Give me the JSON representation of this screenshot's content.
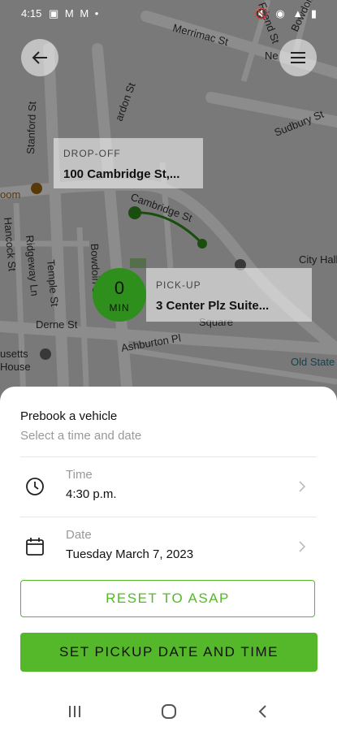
{
  "status_bar": {
    "time": "4:15",
    "left_icons": "▣ M M •",
    "right_icons": "🔇 ◉ ▲ ▮"
  },
  "map": {
    "street_labels": [
      "Merrimac St",
      "Friend St",
      "Bowdoin St",
      "Stanford St",
      "Cambridge St",
      "Sudbury St",
      "Hancock St",
      "Ridgeway Ln",
      "Temple St",
      "Bowdoin St",
      "Derne St",
      "Ashburton Pl",
      "City Hall",
      "Old State",
      "Square",
      "usetts",
      "House",
      "oom",
      "Ne",
      "ardon St",
      "ardon St"
    ],
    "dropoff": {
      "label": "DROP-OFF",
      "address": "100 Cambridge St,..."
    },
    "pickup": {
      "label": "PICK-UP",
      "address": "3 Center Plz Suite..."
    },
    "eta": {
      "value": "0",
      "unit": "MIN"
    }
  },
  "sheet": {
    "title": "Prebook a vehicle",
    "subtitle": "Select a time and date",
    "time_row": {
      "label": "Time",
      "value": "4:30 p.m."
    },
    "date_row": {
      "label": "Date",
      "value": "Tuesday March 7, 2023"
    },
    "reset_label": "RESET TO ASAP",
    "set_label": "SET PICKUP DATE AND TIME"
  },
  "colors": {
    "accent": "#55b82a",
    "eta_bg": "#2f8f1c"
  }
}
